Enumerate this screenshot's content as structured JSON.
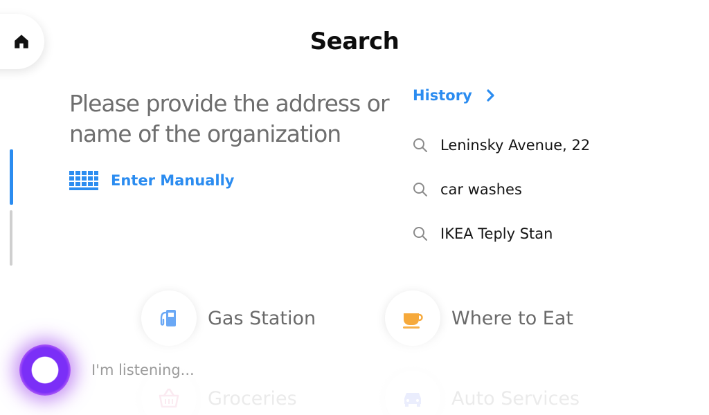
{
  "header": {
    "title": "Search"
  },
  "prompt": {
    "text": "Please provide the address or name of the organization"
  },
  "manual": {
    "label": "Enter Manually"
  },
  "history": {
    "title": "History",
    "items": [
      {
        "label": "Leninsky Avenue, 22"
      },
      {
        "label": "car washes"
      },
      {
        "label": "IKEA Teply Stan"
      }
    ]
  },
  "categories": [
    {
      "label": "Gas Station",
      "icon": "gas-station-icon"
    },
    {
      "label": "Where to Eat",
      "icon": "cup-icon"
    },
    {
      "label": "Groceries",
      "icon": "basket-icon"
    },
    {
      "label": "Auto Services",
      "icon": "car-icon"
    }
  ],
  "assistant": {
    "status": "I'm listening..."
  },
  "colors": {
    "accent": "#2b8cf0",
    "gas": "#6aa8f5",
    "eat": "#f6a93b",
    "assistant": "#7b2ff7"
  }
}
